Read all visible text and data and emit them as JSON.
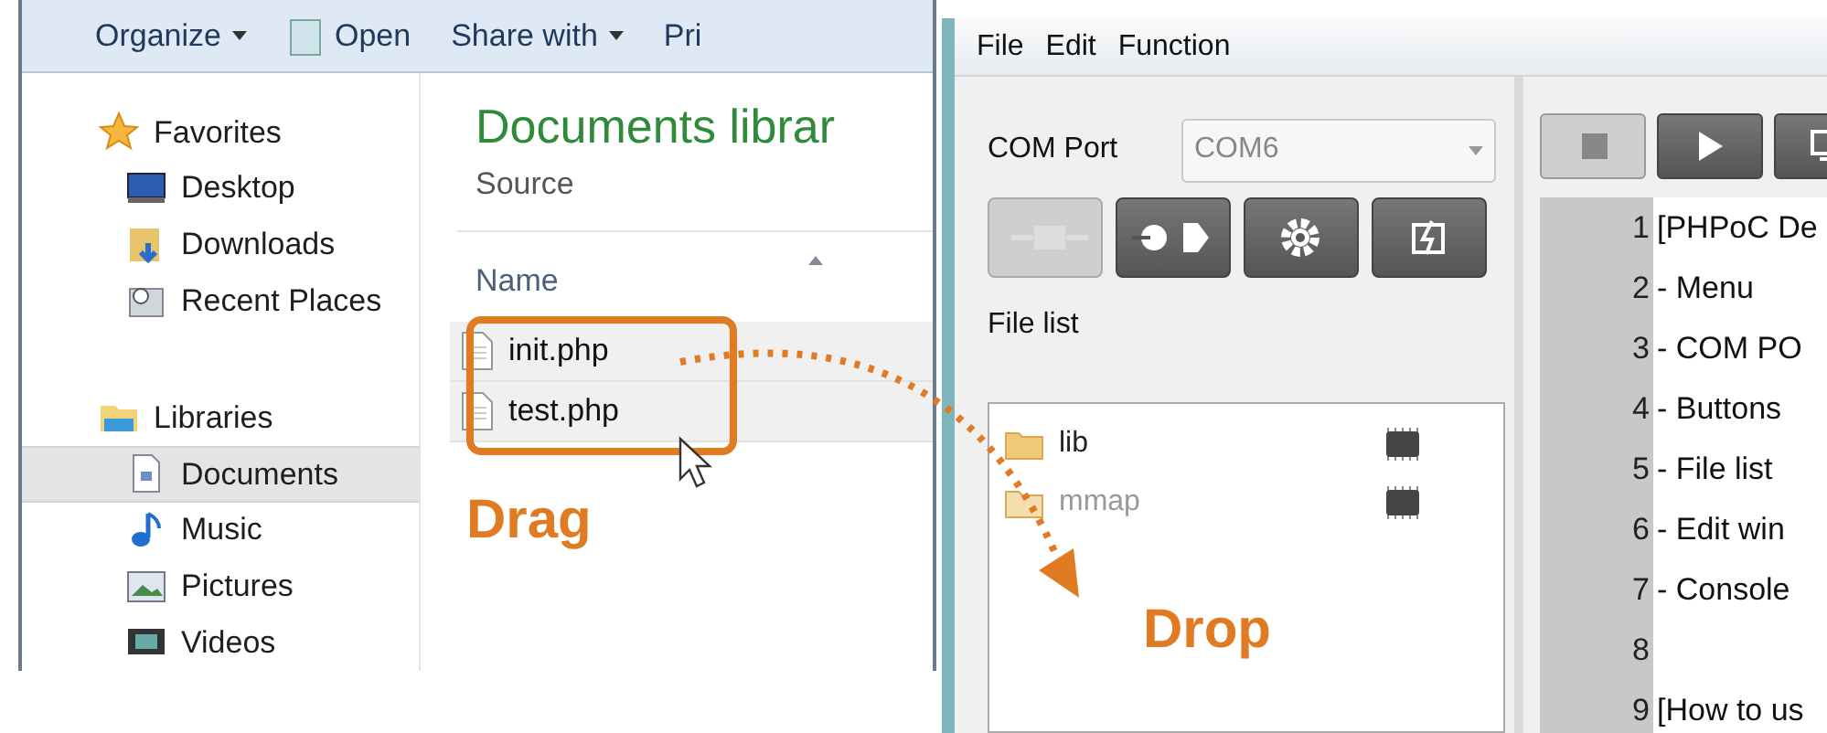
{
  "explorer": {
    "toolbar": [
      {
        "label": "Organize",
        "kind": "menu"
      },
      {
        "label": "Open",
        "kind": "open"
      },
      {
        "label": "Share with",
        "kind": "menu"
      },
      {
        "label": "Pri",
        "kind": "plain"
      }
    ],
    "nav": [
      {
        "label": "Favorites",
        "kind": "star",
        "selected": false
      },
      {
        "label": "Desktop",
        "kind": "desktop",
        "selected": false
      },
      {
        "label": "Downloads",
        "kind": "downloads",
        "selected": false
      },
      {
        "label": "Recent Places",
        "kind": "recent",
        "selected": false
      },
      {
        "label": "Libraries",
        "kind": "libraries",
        "selected": false
      },
      {
        "label": "Documents",
        "kind": "documents",
        "selected": true
      },
      {
        "label": "Music",
        "kind": "music",
        "selected": false
      },
      {
        "label": "Pictures",
        "kind": "pictures",
        "selected": false
      },
      {
        "label": "Videos",
        "kind": "videos",
        "selected": false
      }
    ],
    "title": "Documents librar",
    "subtitle": "Source",
    "column": "Name",
    "files": [
      {
        "name": "init.php"
      },
      {
        "name": "test.php"
      }
    ]
  },
  "phpoc": {
    "menu": [
      "File",
      "Edit",
      "Function"
    ],
    "com_port_label": "COM Port",
    "com_port_value": "COM6",
    "buttons": [
      {
        "kind": "connect",
        "disabled": true
      },
      {
        "kind": "disconnect",
        "disabled": false
      },
      {
        "kind": "settings",
        "disabled": false
      },
      {
        "kind": "upload",
        "disabled": false
      }
    ],
    "file_list_label": "File list",
    "files": [
      {
        "name": "lib",
        "disabled": false
      },
      {
        "name": "mmap",
        "disabled": true
      }
    ],
    "editor_buttons": [
      {
        "kind": "stop",
        "disabled": true
      },
      {
        "kind": "play",
        "disabled": false
      },
      {
        "kind": "monitor",
        "disabled": false
      }
    ],
    "lines": [
      {
        "number": "1",
        "text": "[PHPoC De"
      },
      {
        "number": "2",
        "text": "- Menu"
      },
      {
        "number": "3",
        "text": "- COM PO"
      },
      {
        "number": "4",
        "text": "- Buttons"
      },
      {
        "number": "5",
        "text": "- File list"
      },
      {
        "number": "6",
        "text": "- Edit win"
      },
      {
        "number": "7",
        "text": "- Console"
      },
      {
        "number": "8"
      },
      {
        "number": "9",
        "text": "[How to us"
      }
    ]
  },
  "annotations": {
    "drag": "Drag",
    "drop": "Drop"
  }
}
